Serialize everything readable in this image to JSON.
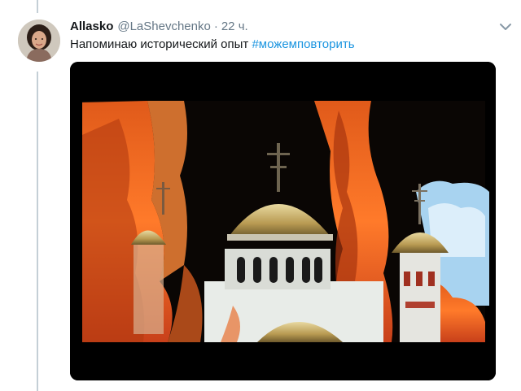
{
  "tweet": {
    "author_name": "Allasko",
    "author_handle": "@LaShevchenko",
    "separator": "·",
    "time": "22 ч.",
    "text": "Напоминаю исторический опыт ",
    "hashtag": "#можемповторить"
  },
  "icons": {
    "menu": "chevron-down-icon",
    "avatar": "avatar-photo"
  },
  "colors": {
    "link": "#1b95e0",
    "secondary_text": "#657786",
    "primary_text": "#14171a",
    "thread_line": "#c4cfd6"
  }
}
